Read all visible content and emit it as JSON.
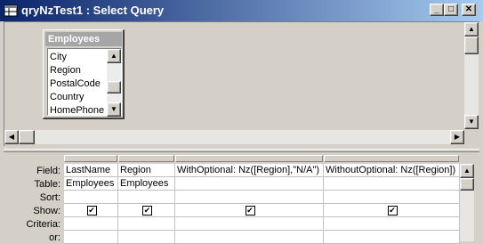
{
  "window": {
    "title": "qryNzTest1 : Select Query"
  },
  "title_buttons": {
    "minimize": "_",
    "maximize": "□",
    "close": "✕"
  },
  "table": {
    "name": "Employees",
    "fields": [
      "City",
      "Region",
      "PostalCode",
      "Country",
      "HomePhone"
    ]
  },
  "grid": {
    "row_labels": {
      "field": "Field:",
      "table": "Table:",
      "sort": "Sort:",
      "show": "Show:",
      "criteria": "Criteria:",
      "or": "or:"
    },
    "columns": [
      {
        "field": "LastName",
        "table": "Employees",
        "sort": "",
        "show": true,
        "criteria": "",
        "or": ""
      },
      {
        "field": "Region",
        "table": "Employees",
        "sort": "",
        "show": true,
        "criteria": "",
        "or": ""
      },
      {
        "field": "WithOptional: Nz([Region],\"N/A\")",
        "table": "",
        "sort": "",
        "show": true,
        "criteria": "",
        "or": ""
      },
      {
        "field": "WithoutOptional: Nz([Region])",
        "table": "",
        "sort": "",
        "show": true,
        "criteria": "",
        "or": ""
      }
    ]
  },
  "scroll_glyphs": {
    "up": "▲",
    "down": "▼",
    "left": "◀",
    "right": "▶"
  },
  "checkmark": "✔"
}
